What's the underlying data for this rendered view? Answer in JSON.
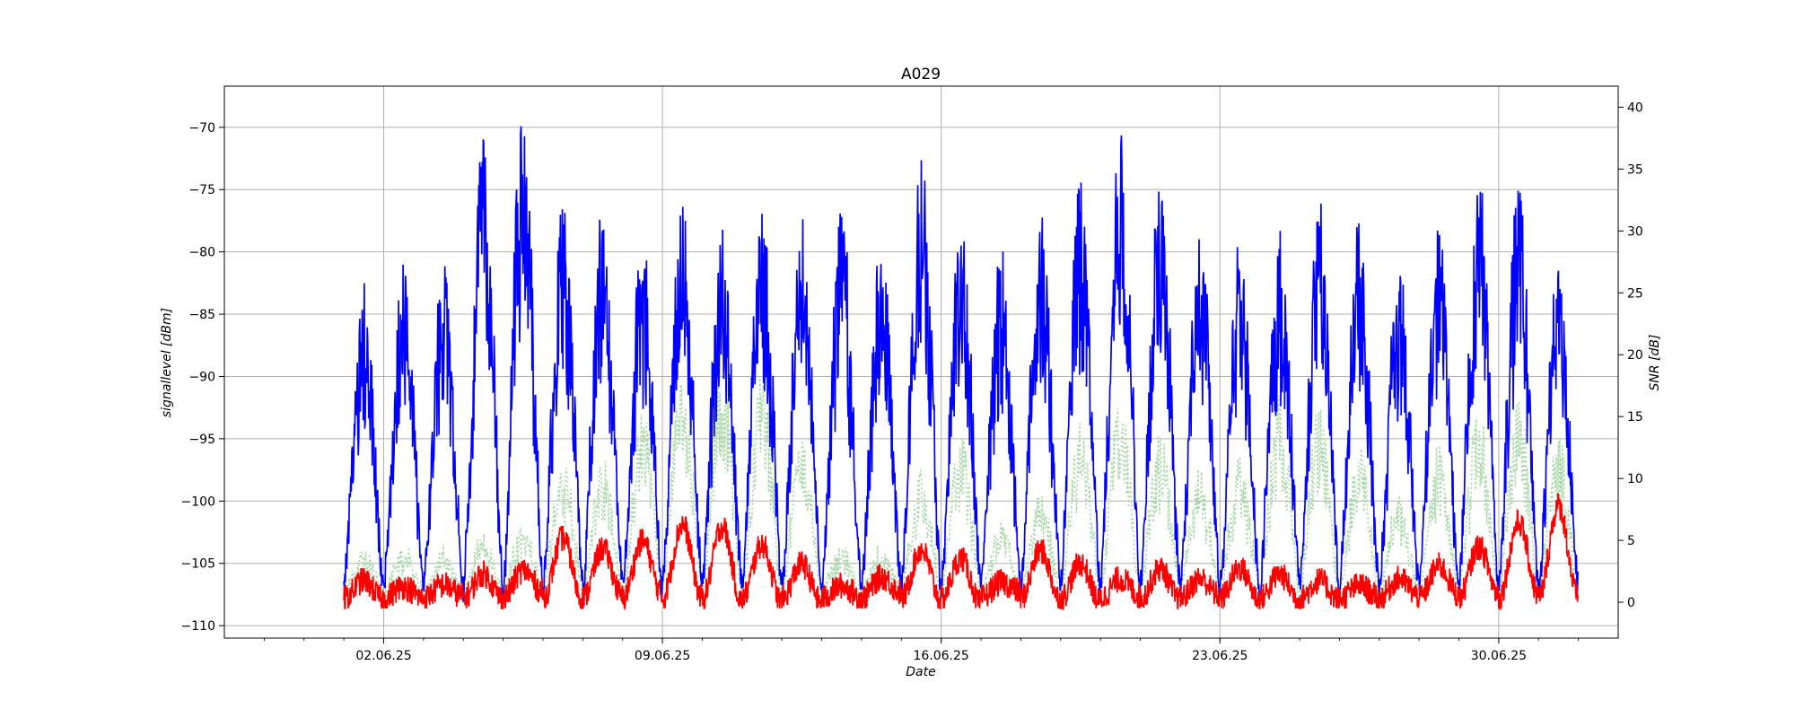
{
  "chart_data": {
    "type": "line",
    "title": "A029",
    "xlabel": "Date",
    "ylabel_left": "signallevel [dBm]",
    "ylabel_right": "SNR [dB]",
    "grid": true,
    "x_range": [
      "2025-05-29",
      "2025-07-03"
    ],
    "x_ticks": [
      {
        "date": "2025-06-02",
        "label": "02.06.25"
      },
      {
        "date": "2025-06-09",
        "label": "09.06.25"
      },
      {
        "date": "2025-06-16",
        "label": "16.06.25"
      },
      {
        "date": "2025-06-23",
        "label": "23.06.25"
      },
      {
        "date": "2025-06-30",
        "label": "30.06.25"
      }
    ],
    "ylim_left": [
      -111,
      -66.7
    ],
    "yticks_left": [
      -110,
      -105,
      -100,
      -95,
      -90,
      -85,
      -80,
      -75,
      -70
    ],
    "ylim_right": [
      -2.9,
      41.7
    ],
    "yticks_right": [
      0,
      5,
      10,
      15,
      20,
      25,
      30,
      35,
      40
    ],
    "series": [
      {
        "axis": "left",
        "color": "#0000ff",
        "style": "solid",
        "daily_peak_dbm": [
          {
            "date": "2025-06-01",
            "peak": -83.5
          },
          {
            "date": "2025-06-02",
            "peak": -81
          },
          {
            "date": "2025-06-03",
            "peak": -82
          },
          {
            "date": "2025-06-04",
            "peak": -72
          },
          {
            "date": "2025-06-05",
            "peak": -69
          },
          {
            "date": "2025-06-06",
            "peak": -76
          },
          {
            "date": "2025-06-07",
            "peak": -77
          },
          {
            "date": "2025-06-08",
            "peak": -80
          },
          {
            "date": "2025-06-09",
            "peak": -77
          },
          {
            "date": "2025-06-10",
            "peak": -79
          },
          {
            "date": "2025-06-11",
            "peak": -77
          },
          {
            "date": "2025-06-12",
            "peak": -78
          },
          {
            "date": "2025-06-13",
            "peak": -77.5
          },
          {
            "date": "2025-06-14",
            "peak": -80
          },
          {
            "date": "2025-06-15",
            "peak": -73
          },
          {
            "date": "2025-06-16",
            "peak": -78
          },
          {
            "date": "2025-06-17",
            "peak": -80
          },
          {
            "date": "2025-06-18",
            "peak": -78
          },
          {
            "date": "2025-06-19",
            "peak": -75
          },
          {
            "date": "2025-06-20",
            "peak": -70
          },
          {
            "date": "2025-06-21",
            "peak": -75
          },
          {
            "date": "2025-06-22",
            "peak": -79
          },
          {
            "date": "2025-06-23",
            "peak": -80
          },
          {
            "date": "2025-06-24",
            "peak": -79.5
          },
          {
            "date": "2025-06-25",
            "peak": -77
          },
          {
            "date": "2025-06-26",
            "peak": -78
          },
          {
            "date": "2025-06-27",
            "peak": -80.5
          },
          {
            "date": "2025-06-28",
            "peak": -78
          },
          {
            "date": "2025-06-29",
            "peak": -74.5
          },
          {
            "date": "2025-06-30",
            "peak": -75.5
          },
          {
            "date": "2025-07-01",
            "peak": -81.5
          }
        ],
        "floor_dbm": -107
      },
      {
        "axis": "right",
        "color": "#ff0000",
        "style": "solid",
        "daily_snr_db": [
          {
            "date": "2025-06-01",
            "value": 1.5
          },
          {
            "date": "2025-06-02",
            "value": 1
          },
          {
            "date": "2025-06-03",
            "value": 1
          },
          {
            "date": "2025-06-04",
            "value": 2
          },
          {
            "date": "2025-06-05",
            "value": 2
          },
          {
            "date": "2025-06-06",
            "value": 5
          },
          {
            "date": "2025-06-07",
            "value": 4
          },
          {
            "date": "2025-06-08",
            "value": 4.5
          },
          {
            "date": "2025-06-09",
            "value": 6
          },
          {
            "date": "2025-06-10",
            "value": 6
          },
          {
            "date": "2025-06-11",
            "value": 4.5
          },
          {
            "date": "2025-06-12",
            "value": 3
          },
          {
            "date": "2025-06-13",
            "value": 1
          },
          {
            "date": "2025-06-14",
            "value": 1.5
          },
          {
            "date": "2025-06-15",
            "value": 4
          },
          {
            "date": "2025-06-16",
            "value": 3.5
          },
          {
            "date": "2025-06-17",
            "value": 1
          },
          {
            "date": "2025-06-18",
            "value": 4
          },
          {
            "date": "2025-06-19",
            "value": 3
          },
          {
            "date": "2025-06-20",
            "value": 1.5
          },
          {
            "date": "2025-06-21",
            "value": 2.5
          },
          {
            "date": "2025-06-22",
            "value": 1.5
          },
          {
            "date": "2025-06-23",
            "value": 2.5
          },
          {
            "date": "2025-06-24",
            "value": 2
          },
          {
            "date": "2025-06-25",
            "value": 1.5
          },
          {
            "date": "2025-06-26",
            "value": 1
          },
          {
            "date": "2025-06-27",
            "value": 1.5
          },
          {
            "date": "2025-06-28",
            "value": 2.5
          },
          {
            "date": "2025-06-29",
            "value": 4
          },
          {
            "date": "2025-06-30",
            "value": 6
          },
          {
            "date": "2025-07-01",
            "value": 7.5
          }
        ]
      },
      {
        "axis": "left",
        "color": "#a8d8a8",
        "style": "dotted",
        "daily_peak_dbm": [
          {
            "date": "2025-06-01",
            "peak": -104
          },
          {
            "date": "2025-06-02",
            "peak": -104
          },
          {
            "date": "2025-06-03",
            "peak": -104
          },
          {
            "date": "2025-06-04",
            "peak": -103
          },
          {
            "date": "2025-06-05",
            "peak": -102
          },
          {
            "date": "2025-06-06",
            "peak": -97
          },
          {
            "date": "2025-06-07",
            "peak": -97
          },
          {
            "date": "2025-06-08",
            "peak": -93
          },
          {
            "date": "2025-06-09",
            "peak": -90
          },
          {
            "date": "2025-06-10",
            "peak": -89
          },
          {
            "date": "2025-06-11",
            "peak": -90
          },
          {
            "date": "2025-06-12",
            "peak": -95
          },
          {
            "date": "2025-06-13",
            "peak": -104
          },
          {
            "date": "2025-06-14",
            "peak": -104
          },
          {
            "date": "2025-06-15",
            "peak": -98
          },
          {
            "date": "2025-06-16",
            "peak": -95
          },
          {
            "date": "2025-06-17",
            "peak": -102
          },
          {
            "date": "2025-06-18",
            "peak": -100
          },
          {
            "date": "2025-06-19",
            "peak": -94
          },
          {
            "date": "2025-06-20",
            "peak": -92
          },
          {
            "date": "2025-06-21",
            "peak": -95
          },
          {
            "date": "2025-06-22",
            "peak": -98
          },
          {
            "date": "2025-06-23",
            "peak": -97
          },
          {
            "date": "2025-06-24",
            "peak": -92
          },
          {
            "date": "2025-06-25",
            "peak": -93
          },
          {
            "date": "2025-06-26",
            "peak": -96
          },
          {
            "date": "2025-06-27",
            "peak": -100
          },
          {
            "date": "2025-06-28",
            "peak": -96
          },
          {
            "date": "2025-06-29",
            "peak": -93
          },
          {
            "date": "2025-06-30",
            "peak": -92
          },
          {
            "date": "2025-07-01",
            "peak": -95
          }
        ],
        "floor_dbm": -107.5
      }
    ]
  }
}
